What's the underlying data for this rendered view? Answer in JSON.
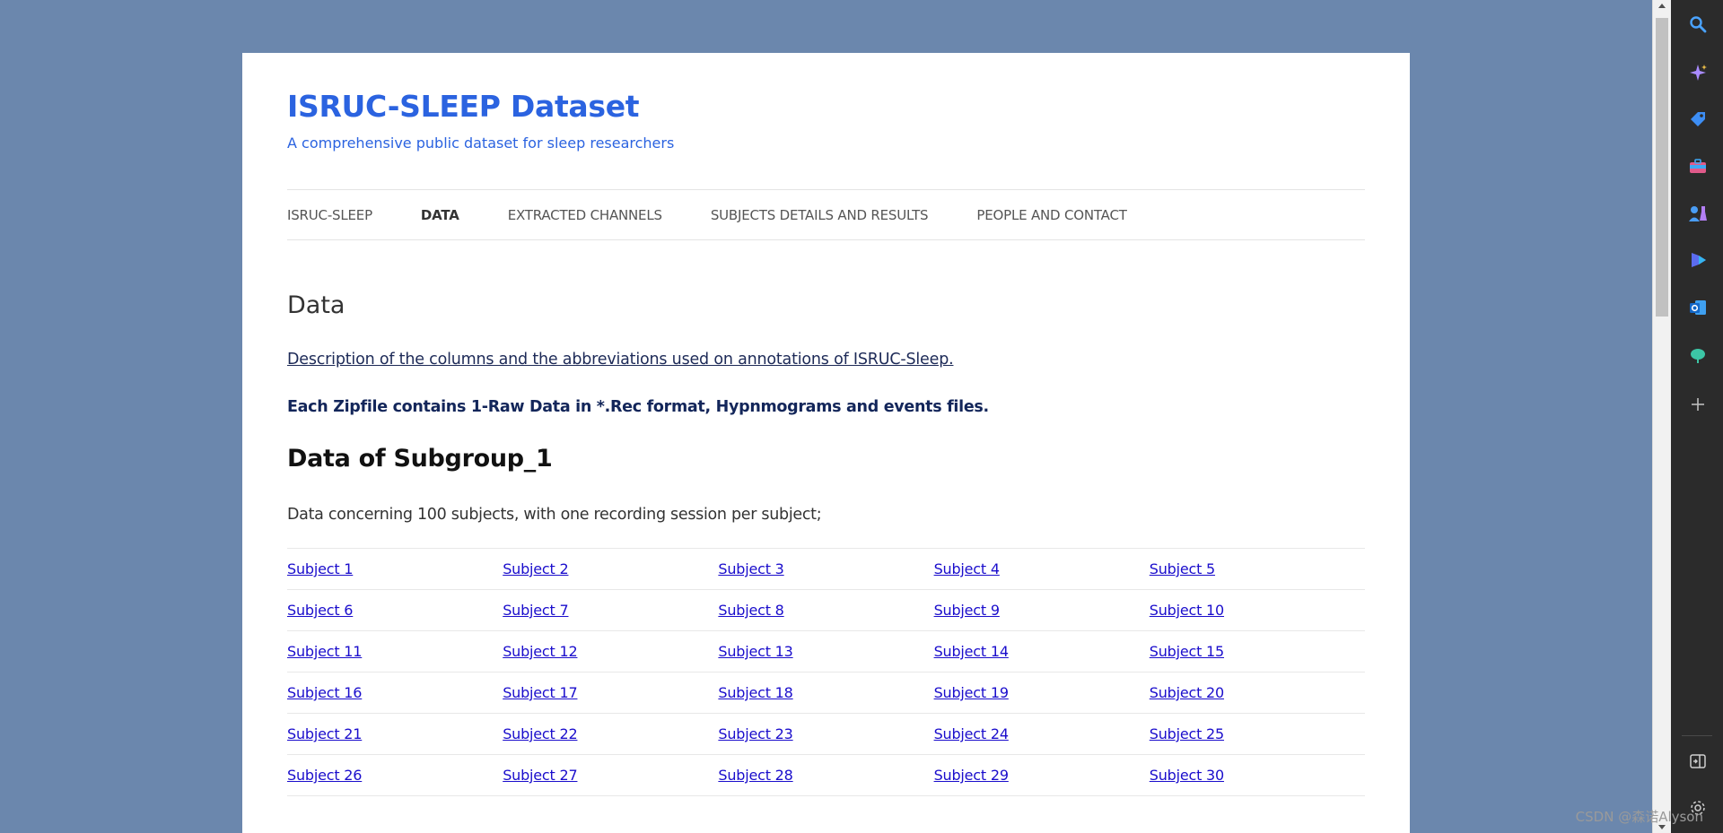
{
  "site": {
    "title": "ISRUC-SLEEP Dataset",
    "tagline": "A comprehensive public dataset for sleep researchers",
    "accent_color": "#2b63e0"
  },
  "nav": {
    "items": [
      {
        "label": "ISRUC-SLEEP",
        "active": false
      },
      {
        "label": "DATA",
        "active": true
      },
      {
        "label": "EXTRACTED CHANNELS",
        "active": false
      },
      {
        "label": "SUBJECTS DETAILS AND RESULTS",
        "active": false
      },
      {
        "label": "PEOPLE AND CONTACT",
        "active": false
      }
    ]
  },
  "content": {
    "page_title": "Data",
    "description_link": "Description of the columns and the abbreviations used on annotations of ISRUC-Sleep. ",
    "zip_note": "Each Zipfile contains 1-Raw Data in *.Rec format, Hypnmograms and events files.",
    "subgroup_title": "Data of Subgroup_1",
    "subgroup_desc": "Data concerning 100 subjects, with one recording session per subject;",
    "subjects": [
      [
        "Subject 1",
        "Subject 2",
        "Subject 3",
        "Subject 4",
        "Subject 5"
      ],
      [
        "Subject 6",
        "Subject 7",
        "Subject 8",
        "Subject 9",
        "Subject 10"
      ],
      [
        "Subject 11",
        "Subject 12",
        "Subject 13",
        "Subject 14",
        "Subject 15"
      ],
      [
        "Subject 16",
        "Subject 17",
        "Subject 18",
        "Subject 19",
        "Subject 20"
      ],
      [
        "Subject 21",
        "Subject 22",
        "Subject 23",
        "Subject 24",
        "Subject 25"
      ],
      [
        "Subject 26",
        "Subject 27",
        "Subject 28",
        "Subject 29",
        "Subject 30"
      ]
    ]
  },
  "sidebar": {
    "icons": [
      "search-icon",
      "copilot-sparkle-icon",
      "shopping-tag-icon",
      "tools-briefcase-icon",
      "games-icon",
      "bing-icon",
      "outlook-icon",
      "drop-tree-icon",
      "add-icon"
    ],
    "bottom_icons": [
      "split-screen-icon",
      "settings-gear-icon"
    ]
  },
  "watermark": "CSDN @森诺Alyson"
}
